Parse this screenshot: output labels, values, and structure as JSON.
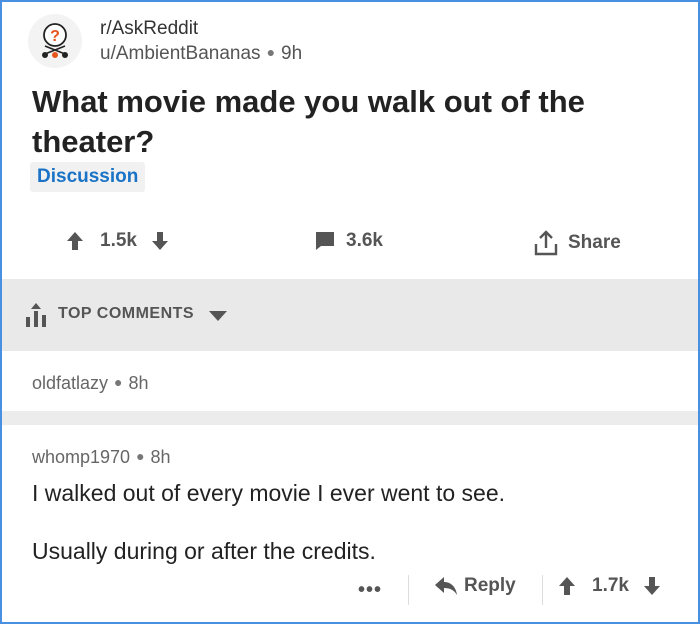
{
  "post": {
    "subreddit": "r/AskReddit",
    "author": "u/AmbientBananas",
    "age": "9h",
    "title": "What movie made you walk out of the theater?",
    "flair": "Discussion",
    "score": "1.5k",
    "comments": "3.6k",
    "share_label": "Share"
  },
  "sort": {
    "label": "TOP COMMENTS"
  },
  "comments": [
    {
      "author": "oldfatlazy",
      "age": "8h"
    },
    {
      "author": "whomp1970",
      "age": "8h",
      "body_lines": [
        "I walked out of every movie I ever went to see.",
        "Usually during or after the credits."
      ],
      "more_label": "•••",
      "reply_label": "Reply",
      "score": "1.7k"
    }
  ],
  "colors": {
    "flair": "#1a73c6",
    "frame_border": "#4a90e2",
    "text_muted": "#555555"
  },
  "icons": [
    "subreddit-avatar-icon",
    "upvote-icon",
    "downvote-icon",
    "comment-bubble-icon",
    "share-icon",
    "top-sort-icon",
    "caret-down-icon",
    "reply-arrow-icon"
  ]
}
